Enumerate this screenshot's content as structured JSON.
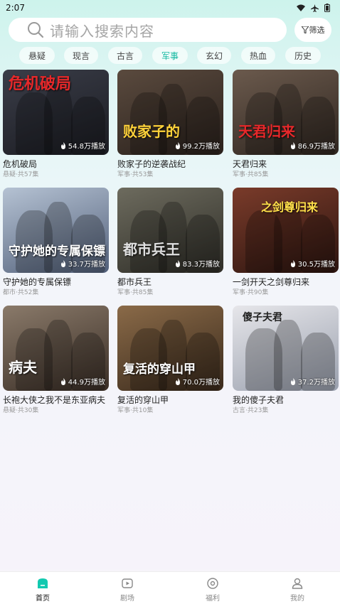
{
  "status": {
    "time": "2:07"
  },
  "search": {
    "placeholder": "请输入搜索内容",
    "filter_label": "筛选"
  },
  "tabs": [
    {
      "label": "悬疑",
      "active": false
    },
    {
      "label": "现言",
      "active": false
    },
    {
      "label": "古言",
      "active": false
    },
    {
      "label": "军事",
      "active": true
    },
    {
      "label": "玄幻",
      "active": false
    },
    {
      "label": "热血",
      "active": false
    },
    {
      "label": "历史",
      "active": false
    }
  ],
  "cards": [
    {
      "title": "危机破局",
      "meta": "悬疑·共57集",
      "plays": "54.8万播放",
      "poster_text": "危机破局",
      "colors": [
        "#3a3d48",
        "#1b1c22"
      ]
    },
    {
      "title": "败家子的逆袭战纪",
      "meta": "军事·共53集",
      "plays": "99.2万播放",
      "poster_text": "败家子的",
      "colors": [
        "#5a4a3e",
        "#2a211c"
      ]
    },
    {
      "title": "天君归来",
      "meta": "军事·共85集",
      "plays": "86.9万播放",
      "poster_text": "天君归来",
      "colors": [
        "#6b5a4d",
        "#2f2620"
      ]
    },
    {
      "title": "守护她的专属保镖",
      "meta": "都市·共52集",
      "plays": "33.7万播放",
      "poster_text": "守护她的专属保镖",
      "colors": [
        "#b5c2d3",
        "#52607a"
      ]
    },
    {
      "title": "都市兵王",
      "meta": "军事·共85集",
      "plays": "83.3万播放",
      "poster_text": "都市兵王",
      "colors": [
        "#6d6b5e",
        "#2e2d27"
      ]
    },
    {
      "title": "一剑开天之剑尊归来",
      "meta": "军事·共90集",
      "plays": "30.5万播放",
      "poster_text": "之剑尊归来",
      "colors": [
        "#7a3b2a",
        "#2c1510"
      ]
    },
    {
      "title": "长袍大侠之我不是东亚病夫",
      "meta": "悬疑·共30集",
      "plays": "44.9万播放",
      "poster_text": "病夫",
      "colors": [
        "#8a7a6a",
        "#3a2e26"
      ]
    },
    {
      "title": "复活的穿山甲",
      "meta": "军事·共10集",
      "plays": "70.0万播放",
      "poster_text": "复活的穿山甲",
      "colors": [
        "#8a6a48",
        "#3a2a1c"
      ]
    },
    {
      "title": "我的傻子夫君",
      "meta": "古言·共23集",
      "plays": "37.2万播放",
      "poster_text": "傻子夫君",
      "colors": [
        "#e6e6ea",
        "#9aa0ae"
      ]
    }
  ],
  "nav": [
    {
      "label": "首页",
      "icon": "home-icon",
      "active": true
    },
    {
      "label": "剧场",
      "icon": "theater-icon",
      "active": false
    },
    {
      "label": "福利",
      "icon": "welfare-icon",
      "active": false
    },
    {
      "label": "我的",
      "icon": "profile-icon",
      "active": false
    }
  ],
  "colors": {
    "accent": "#12b8a0"
  }
}
